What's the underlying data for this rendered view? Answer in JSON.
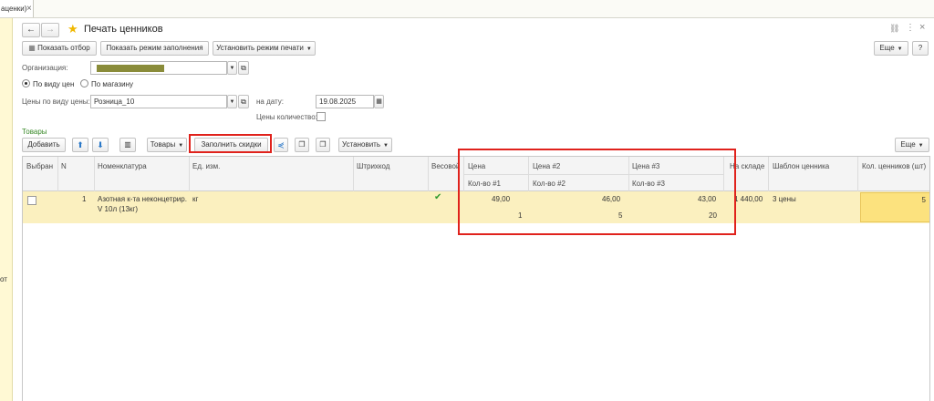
{
  "tab": {
    "label": "аценки)",
    "close": "×"
  },
  "left_panel_text": "от",
  "window": {
    "back": "←",
    "forward": "→",
    "title": "Печать ценников",
    "link_icon": "🔗",
    "more_icon": "⋮",
    "close_icon": "×",
    "more_button": "Еще",
    "help_button": "?"
  },
  "toolbar": {
    "show_filter": "Показать отбор",
    "show_fill_mode": "Показать режим заполнения",
    "set_print_mode": "Установить режим печати"
  },
  "form": {
    "organization_label": "Организация:",
    "by_price_type": "По виду цен",
    "by_store": "По магазину",
    "price_type_label": "Цены по виду цены:",
    "price_type_value": "Розница_10",
    "date_label": "на дату:",
    "date_value": "19.08.2025",
    "prices_qty_label": "Цены количество:"
  },
  "goods": {
    "section_label": "Товары",
    "add_button": "Добавить",
    "goods_button": "Товары",
    "fill_discounts_button": "Заполнить скидки",
    "set_button": "Установить",
    "more_button": "Еще"
  },
  "table": {
    "headers": {
      "selected": "Выбран",
      "n": "N",
      "nomenclature": "Номенклатура",
      "unit": "Ед. изм.",
      "barcode": "Штрихкод",
      "weight": "Весовой",
      "price": "Цена",
      "qty1": "Кол-во #1",
      "price2": "Цена #2",
      "qty2": "Кол-во #2",
      "price3": "Цена #3",
      "qty3": "Кол-во #3",
      "stock": "На складе",
      "template": "Шаблон ценника",
      "count": "Кол. ценников (шт)"
    },
    "row": {
      "n": "1",
      "nomenclature_line1": "Азотная к-та неконцетрир.",
      "nomenclature_line2": "V 10л (13кг)",
      "unit": "кг",
      "weight_check": "✔",
      "price": "49,00",
      "qty1": "1",
      "price2": "46,00",
      "qty2": "5",
      "price3": "43,00",
      "qty3": "20",
      "stock": "1 440,00",
      "template": "3 цены",
      "count": "5"
    }
  },
  "colors": {
    "accent": "#e0221c",
    "highlight_row": "#fbf0bf",
    "section_green": "#3a8a2a"
  }
}
